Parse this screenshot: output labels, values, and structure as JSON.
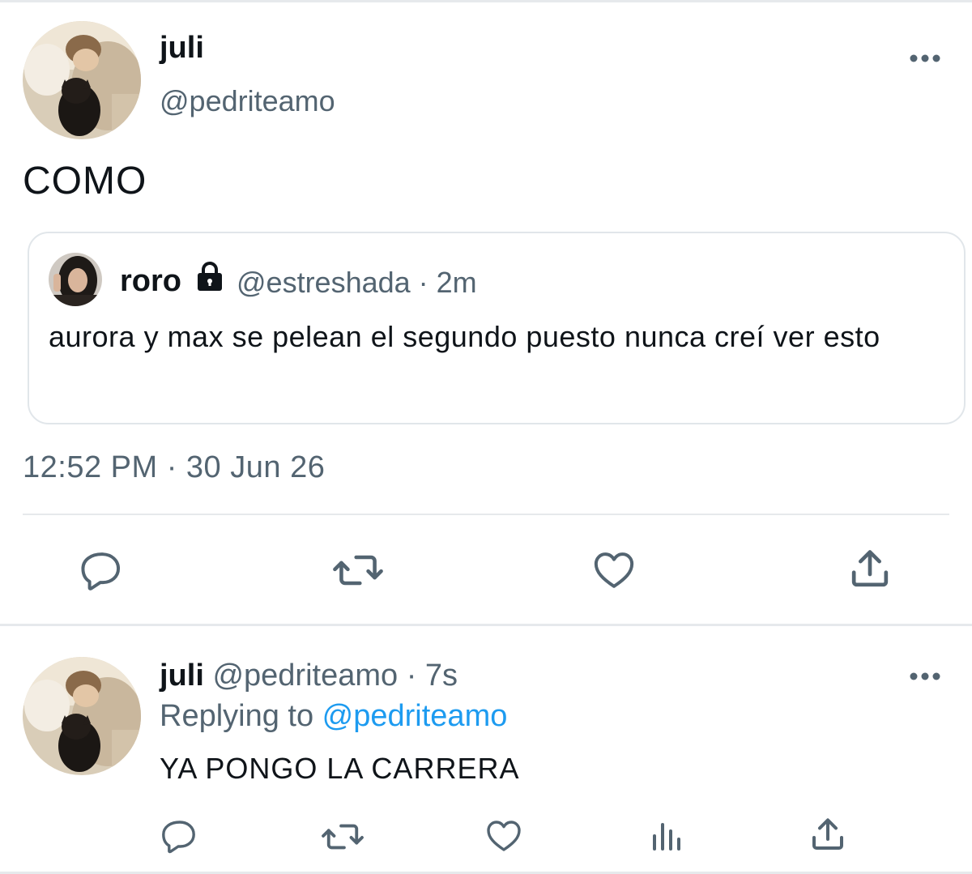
{
  "main_tweet": {
    "author_name": "juli",
    "author_handle": "@pedriteamo",
    "text": "COMO",
    "timestamp": "12:52 PM · 30 Jun 26",
    "avatar_icon": "profile-photo-person-with-black-dog",
    "more_icon": "more-horizontal-icon"
  },
  "quoted_tweet": {
    "author_name": "roro",
    "lock_icon": "lock-icon",
    "meta": "@estreshada · 2m",
    "text": "aurora y max se pelean el segundo puesto nunca creí ver esto",
    "avatar_icon": "profile-photo-person-dark-hair"
  },
  "actions": {
    "reply_icon": "reply-icon",
    "retweet_icon": "retweet-icon",
    "like_icon": "heart-icon",
    "share_icon": "share-icon",
    "stats_icon": "analytics-icon"
  },
  "reply_tweet": {
    "author_name": "juli",
    "meta": " @pedriteamo · 7s",
    "replying_prefix": "Replying to ",
    "replying_mention": "@pedriteamo",
    "text": "YA PONGO LA CARRERA"
  },
  "colors": {
    "text_primary": "#0f1419",
    "text_secondary": "#536471",
    "mention": "#1d9bf0",
    "divider": "#e6e9ec"
  }
}
